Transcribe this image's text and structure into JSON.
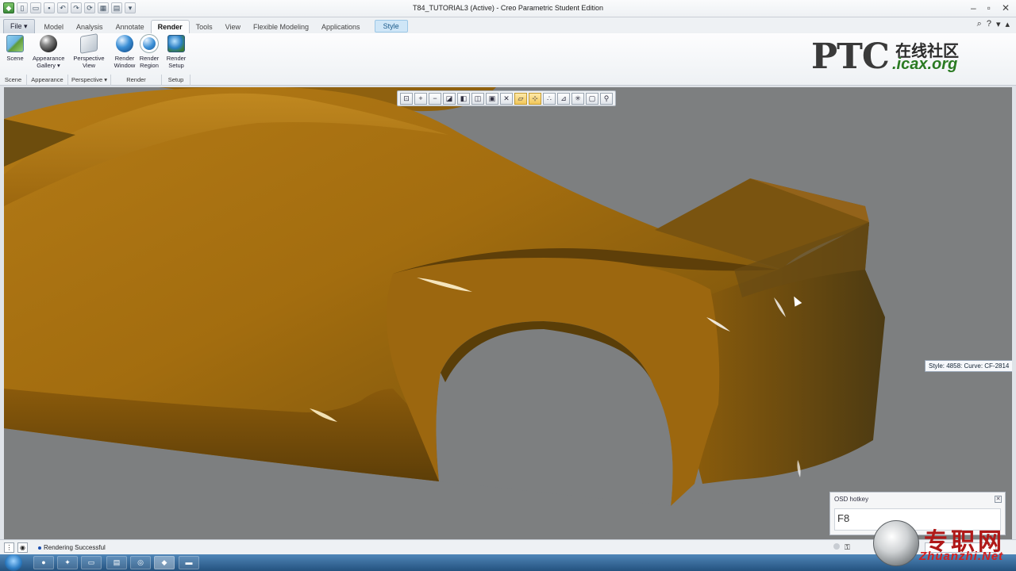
{
  "window": {
    "title": "T84_TUTORIAL3 (Active) - Creo Parametric Student Edition"
  },
  "tabs": [
    {
      "label": "File ▾",
      "kind": "file"
    },
    {
      "label": "Model"
    },
    {
      "label": "Analysis"
    },
    {
      "label": "Annotate"
    },
    {
      "label": "Render",
      "active": true
    },
    {
      "label": "Tools"
    },
    {
      "label": "View"
    },
    {
      "label": "Flexible Modeling"
    },
    {
      "label": "Applications"
    },
    {
      "label": "Style",
      "kind": "style"
    }
  ],
  "ribbon": {
    "scene": "Scene",
    "appearance": "Appearance Gallery ▾",
    "perspective": "Perspective View",
    "render_window": "Render Window",
    "render_region": "Render Region",
    "render_setup": "Render Setup",
    "groups": [
      "Scene",
      "Appearance",
      "Perspective ▾",
      "Render",
      "Setup"
    ]
  },
  "logo": {
    "brand": "PTC",
    "community": "在线社区",
    "site": ".icax.org"
  },
  "viewport": {
    "tooltip": "Style: 4858: Curve:  CF-2814",
    "osd": {
      "title": "OSD hotkey",
      "key": "F8"
    }
  },
  "status": {
    "message": "Rendering Successful"
  },
  "watermark": {
    "cn": "专职网",
    "net": "Zhuanzhi.Net"
  },
  "colors": {
    "body_paint": "#a66f12",
    "background": "#7d7f80",
    "style_tab": "#cfe6f7"
  }
}
